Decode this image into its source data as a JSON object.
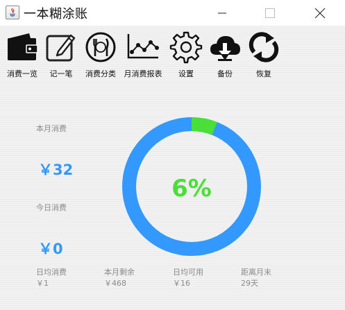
{
  "window": {
    "title": "一本糊涂账"
  },
  "toolbar": {
    "items": [
      {
        "label": "消费一览",
        "icon": "wallet-icon"
      },
      {
        "label": "记一笔",
        "icon": "edit-icon"
      },
      {
        "label": "消费分类",
        "icon": "cutlery-icon"
      },
      {
        "label": "月消费报表",
        "icon": "line-chart-icon"
      },
      {
        "label": "设置",
        "icon": "gear-icon"
      },
      {
        "label": "备份",
        "icon": "cloud-download-icon"
      },
      {
        "label": "恢复",
        "icon": "refresh-icon"
      }
    ]
  },
  "summary": {
    "month_label": "本月消费",
    "month_value": "￥32",
    "today_label": "今日消费",
    "today_value": "￥0"
  },
  "gauge": {
    "percent": 6,
    "text": "6%",
    "track_color": "#3399ff",
    "fill_color": "#4ade38"
  },
  "bottom": {
    "items": [
      {
        "label": "日均消费",
        "value": "￥1"
      },
      {
        "label": "本月剩余",
        "value": "￥468"
      },
      {
        "label": "日均可用",
        "value": "￥16"
      },
      {
        "label": "距离月末",
        "value": "29天"
      }
    ]
  }
}
